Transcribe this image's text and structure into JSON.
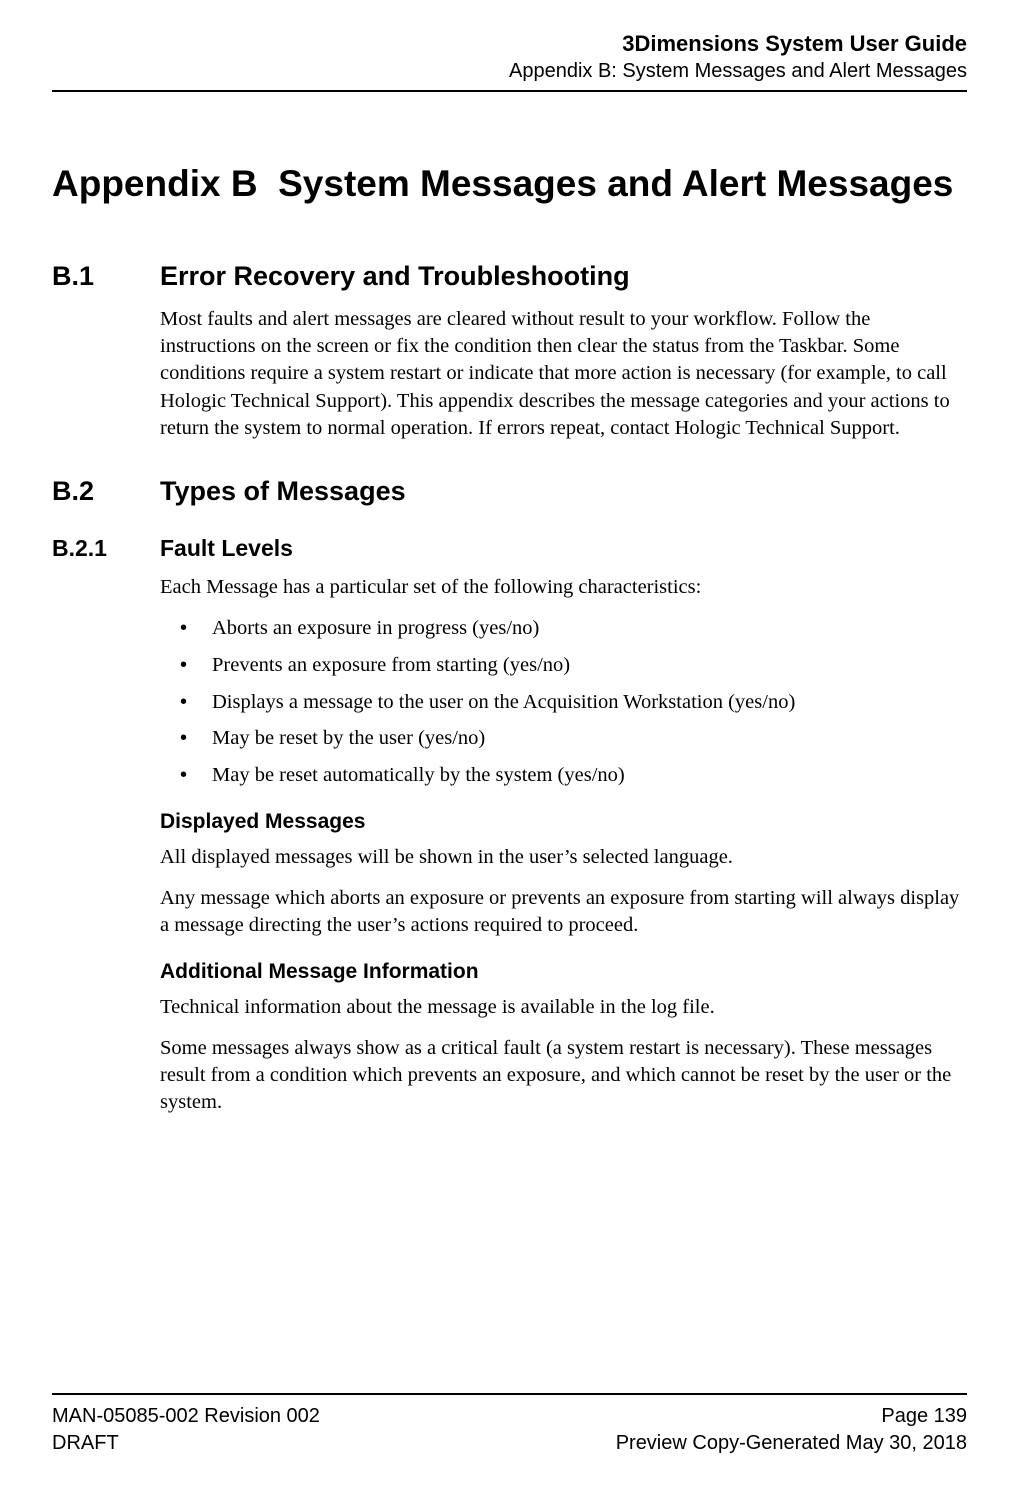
{
  "header": {
    "doc_title": "3Dimensions System User Guide",
    "doc_subtitle": "Appendix B: System Messages and Alert Messages"
  },
  "appendix": {
    "label": "Appendix B",
    "title": "System Messages and Alert Messages"
  },
  "sections": {
    "b1": {
      "num": "B.1",
      "title": "Error Recovery and Troubleshooting",
      "para": "Most faults and alert messages are cleared without result to your workflow. Follow the instructions on the screen or fix the condition then clear the status from the Taskbar. Some conditions require a system restart or indicate that more action is necessary (for example, to call Hologic Technical Support). This appendix describes the message categories and your actions to return the system to normal operation. If errors repeat, contact Hologic Technical Support."
    },
    "b2": {
      "num": "B.2",
      "title": "Types of Messages"
    },
    "b21": {
      "num": "B.2.1",
      "title": "Fault Levels",
      "intro": "Each Message has a particular set of the following characteristics:",
      "bullets": [
        "Aborts an exposure in progress (yes/no)",
        "Prevents an exposure from starting (yes/no)",
        "Displays a message to the user on the Acquisition Workstation (yes/no)",
        "May be reset by the user (yes/no)",
        "May be reset automatically by the system (yes/no)"
      ],
      "displayed_heading": "Displayed Messages",
      "displayed_p1": "All displayed messages will be shown in the user’s selected language.",
      "displayed_p2": "Any message which aborts an exposure or prevents an exposure from starting will always display a message directing the user’s actions required to proceed.",
      "additional_heading": "Additional Message Information",
      "additional_p1": "Technical information about the message is available in the log file.",
      "additional_p2": "Some messages always show as a critical fault (a system restart is necessary). These messages result from a condition which prevents an exposure, and which cannot be reset by the user or the system."
    }
  },
  "footer": {
    "left1": "MAN-05085-002 Revision 002",
    "right1": "Page 139",
    "left2": "DRAFT",
    "right2": "Preview Copy-Generated May 30, 2018"
  }
}
